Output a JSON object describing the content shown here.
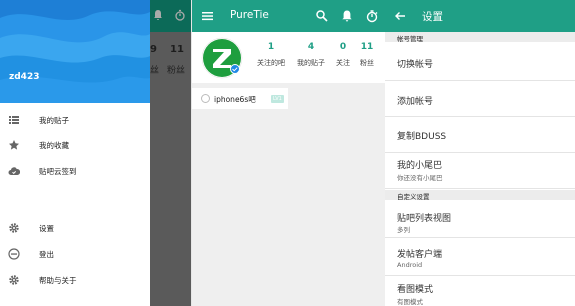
{
  "drawer": {
    "username": "zd423",
    "items": [
      {
        "label": "我的贴子",
        "icon": "list-icon"
      },
      {
        "label": "我的收藏",
        "icon": "star-icon"
      },
      {
        "label": "贴吧云签到",
        "icon": "cloud-icon"
      },
      {
        "label": "设置",
        "icon": "gear-icon"
      },
      {
        "label": "登出",
        "icon": "logout-icon"
      },
      {
        "label": "帮助与关于",
        "icon": "help-gear-icon"
      }
    ],
    "behind": {
      "num1": "9",
      "num2": "11",
      "lbl1": "丝",
      "lbl2": "粉丝"
    }
  },
  "profile": {
    "title": "PureTie",
    "stats": [
      {
        "num": "1",
        "label": "关注的吧"
      },
      {
        "num": "4",
        "label": "我的贴子"
      },
      {
        "num": "0",
        "label": "关注"
      },
      {
        "num": "11",
        "label": "粉丝"
      }
    ],
    "forum": {
      "name": "iphone6s吧",
      "level": "LV1"
    }
  },
  "settings": {
    "title": "设置",
    "sections": [
      {
        "header": "帐号管理"
      },
      {
        "header": "自定义设置"
      }
    ],
    "rows": [
      {
        "title": "切换帐号",
        "sub": ""
      },
      {
        "title": "添加帐号",
        "sub": ""
      },
      {
        "title": "复制BDUSS",
        "sub": ""
      },
      {
        "title": "我的小尾巴",
        "sub": "你还没有小尾巴"
      },
      {
        "title": "贴吧列表视图",
        "sub": "多列"
      },
      {
        "title": "发帖客户端",
        "sub": "Android"
      },
      {
        "title": "看图模式",
        "sub": "有图模式"
      }
    ]
  },
  "colors": {
    "accent": "#1f9f86",
    "header_blue": "#1e88e5"
  }
}
